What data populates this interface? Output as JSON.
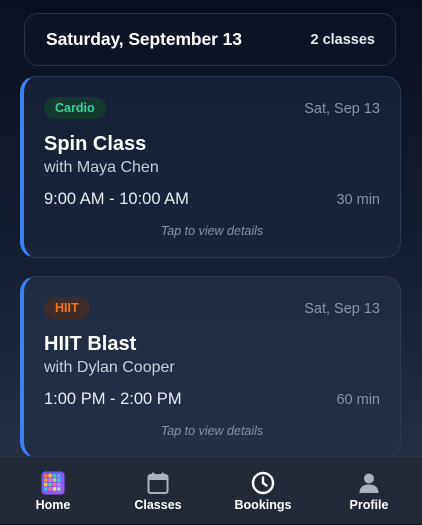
{
  "header": {
    "date_title": "Saturday, September 13",
    "class_count": "2 classes"
  },
  "classes": [
    {
      "category": "Cardio",
      "category_color": "#34d399",
      "date": "Sat, Sep 13",
      "name": "Spin Class",
      "instructor": "with Maya Chen",
      "time": "9:00 AM - 10:00 AM",
      "duration": "30 min",
      "hint": "Tap to view details"
    },
    {
      "category": "HIIT",
      "category_color": "#f97316",
      "date": "Sat, Sep 13",
      "name": "HIIT Blast",
      "instructor": "with Dylan Cooper",
      "time": "1:00 PM - 2:00 PM",
      "duration": "60 min",
      "hint": "Tap to view details"
    }
  ],
  "tabs": [
    {
      "label": "Home",
      "icon": "home-grid-icon"
    },
    {
      "label": "Classes",
      "icon": "calendar-icon"
    },
    {
      "label": "Bookings",
      "icon": "clock-icon"
    },
    {
      "label": "Profile",
      "icon": "person-icon"
    }
  ],
  "colors": {
    "accent": "#3b82f6",
    "background": "#151d30",
    "tabbar": "#222a38"
  }
}
